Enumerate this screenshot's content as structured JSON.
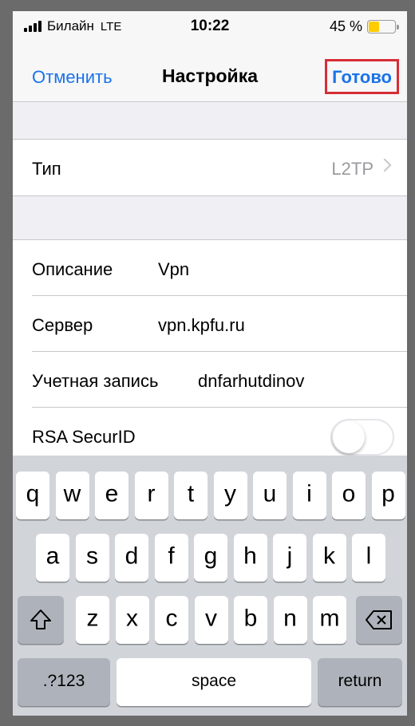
{
  "status_bar": {
    "carrier": "Билайн",
    "network": "LTE",
    "time": "10:22",
    "battery_text": "45 %",
    "battery_level": 0.45,
    "battery_color": "#ffcc00"
  },
  "nav": {
    "cancel_label": "Отменить",
    "title": "Настройка",
    "done_label": "Готово",
    "accent_color": "#1a73e8",
    "highlight_color": "#d72d36"
  },
  "type_row": {
    "label": "Тип",
    "value": "L2TP"
  },
  "fields": {
    "description": {
      "label": "Описание",
      "value": "Vpn"
    },
    "server": {
      "label": "Сервер",
      "value": "vpn.kpfu.ru"
    },
    "account": {
      "label": "Учетная запись",
      "value": "dnfarhutdinov"
    },
    "rsa": {
      "label": "RSA SecurID",
      "toggle_on": false
    }
  },
  "keyboard": {
    "row1": [
      "q",
      "w",
      "e",
      "r",
      "t",
      "y",
      "u",
      "i",
      "o",
      "p"
    ],
    "row2": [
      "a",
      "s",
      "d",
      "f",
      "g",
      "h",
      "j",
      "k",
      "l"
    ],
    "row3": [
      "z",
      "x",
      "c",
      "v",
      "b",
      "n",
      "m"
    ],
    "numbers_label": ".?123",
    "space_label": "space",
    "return_label": "return",
    "shift_icon": "shift-icon",
    "backspace_icon": "backspace-icon"
  }
}
